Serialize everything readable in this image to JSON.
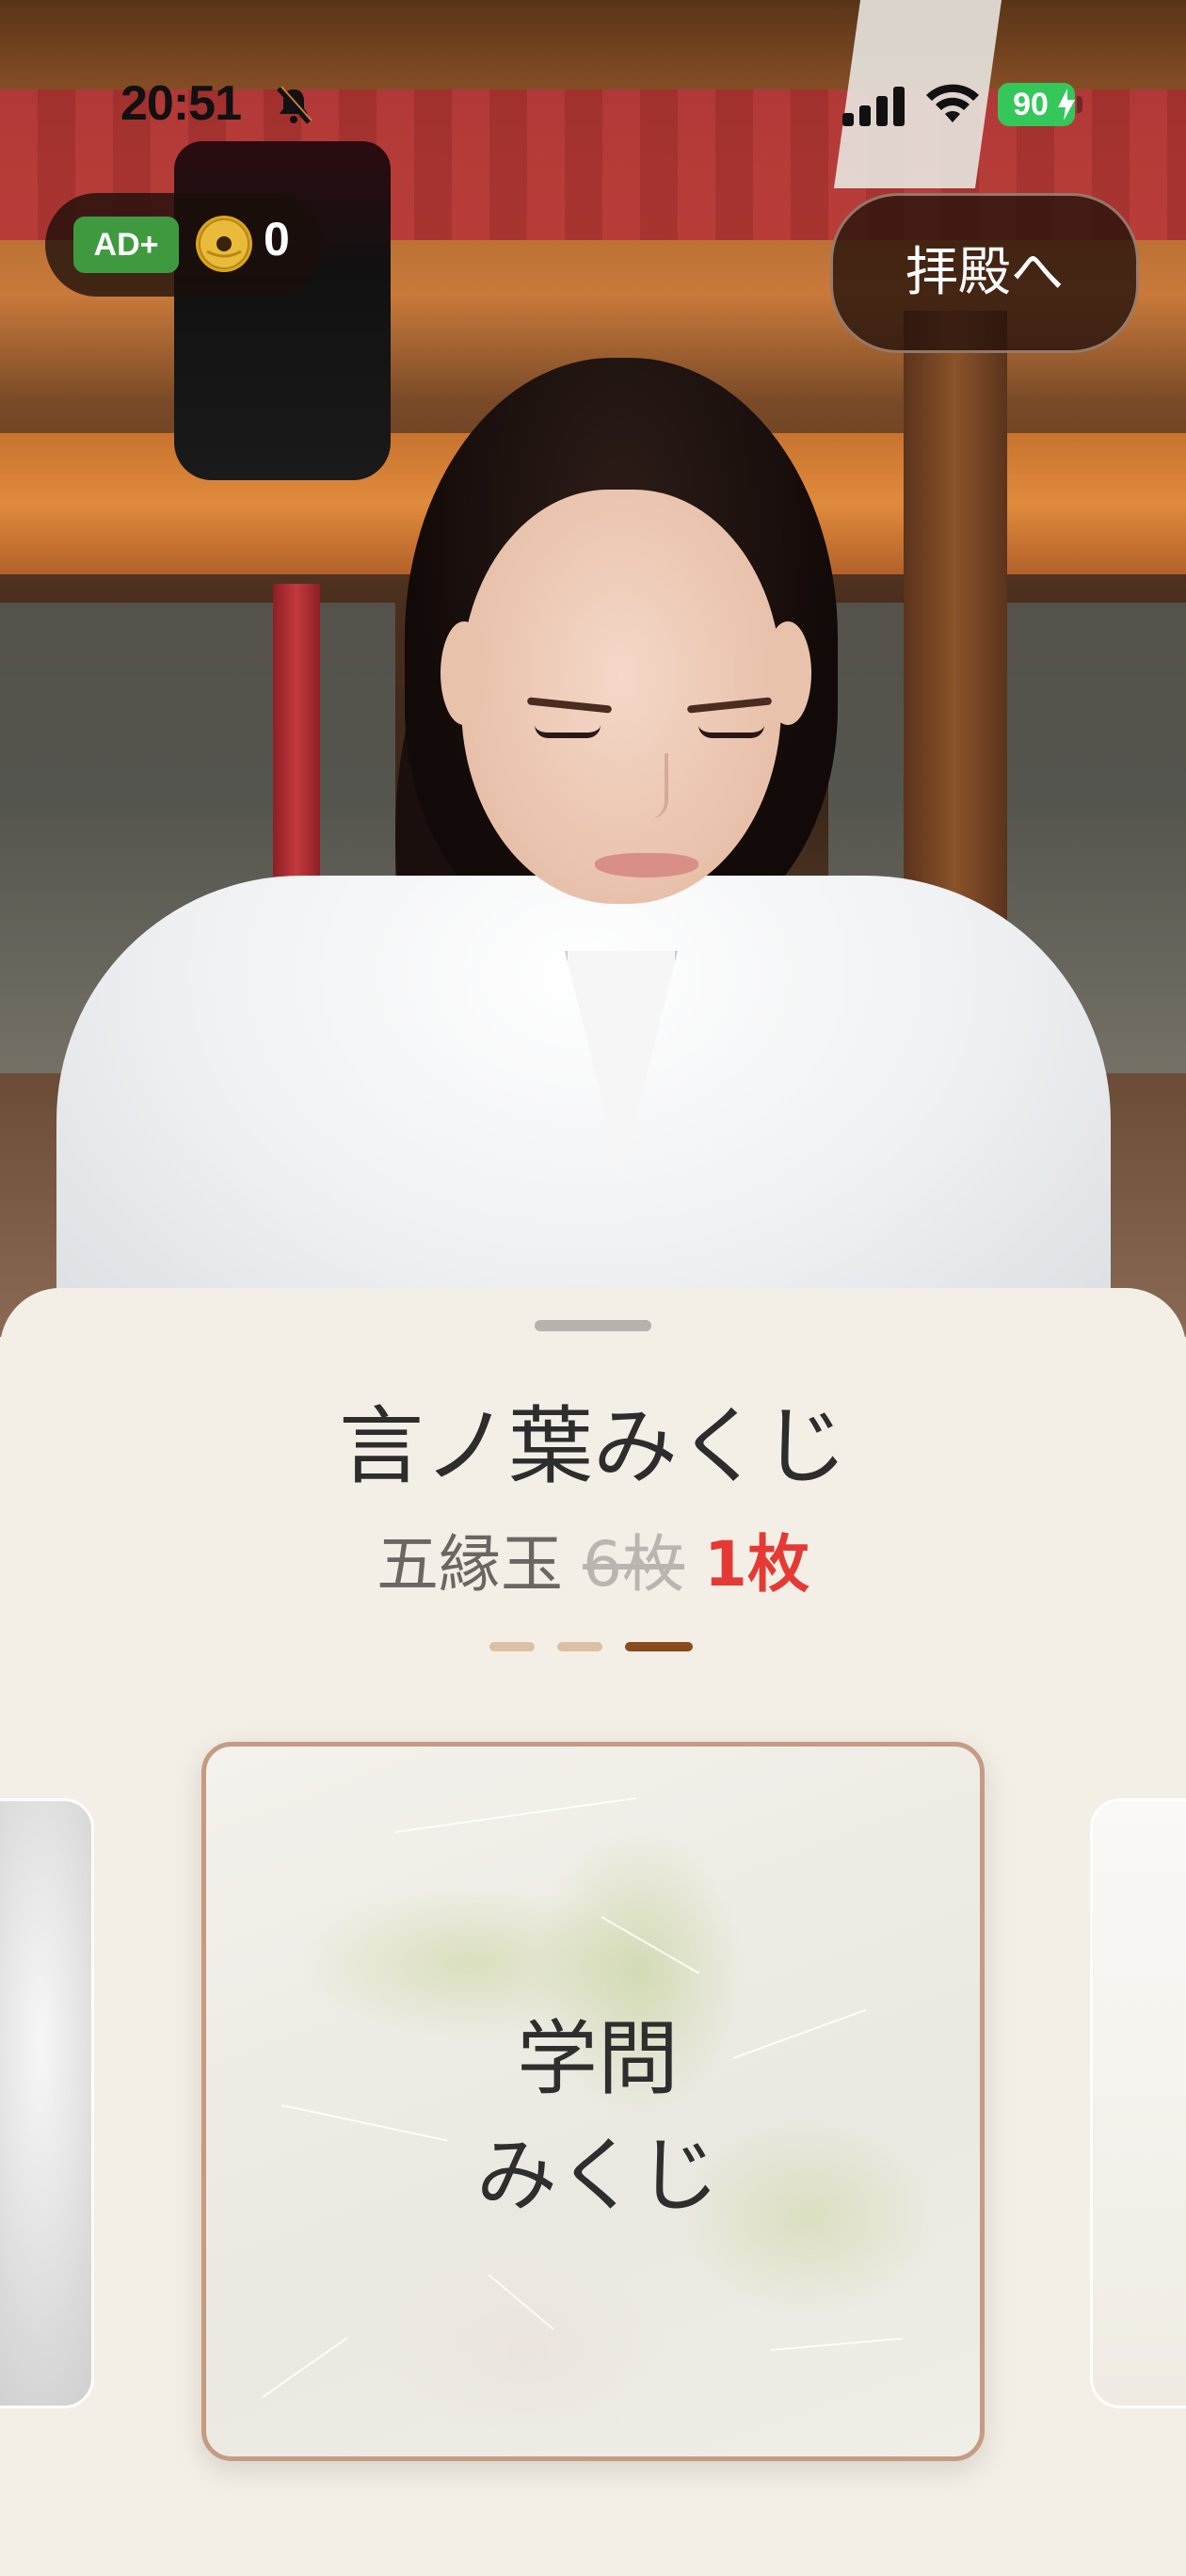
{
  "status_bar": {
    "time": "20:51",
    "battery": "90",
    "icons": [
      "bell-slash-icon",
      "cellular-signal-icon",
      "wifi-icon",
      "battery-charging-icon"
    ]
  },
  "currency": {
    "ad_badge": "AD+",
    "coin_count": "0",
    "icon": "five-yen-coin-icon"
  },
  "shrine_button": {
    "label": "拝殿へ"
  },
  "sheet": {
    "title": "言ノ葉みくじ",
    "price": {
      "base": "五縁玉",
      "old": "6枚",
      "new": "1枚"
    },
    "page_dots": {
      "count": 3,
      "active_index": 2
    },
    "cards": [
      {
        "position": "previous",
        "label": ""
      },
      {
        "position": "current",
        "label_line1": "学問",
        "label_line2": "みくじ"
      },
      {
        "position": "next",
        "label": ""
      }
    ]
  },
  "colors": {
    "accent_red": "#e53a33",
    "sheet_bg": "#f3efe6",
    "ad_green": "#3f9a3f",
    "dot_active": "#8a4a1c",
    "dot_inactive": "#dcc0a6",
    "card_border": "#c49c83"
  }
}
